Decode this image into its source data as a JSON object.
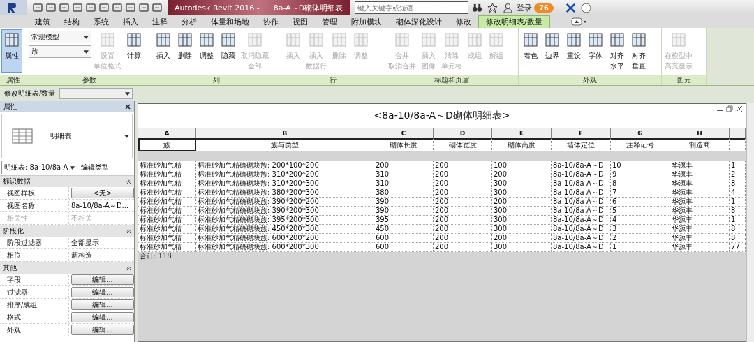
{
  "title_bar": {
    "app_title": "Autodesk Revit 2016 -",
    "doc_title": "8a-A～D砌体明细表",
    "search": {
      "placeholder": "键入关键字或短语"
    },
    "sign_in": "登录",
    "badge": "76"
  },
  "tabs": [
    {
      "label": "建筑",
      "selected": false
    },
    {
      "label": "结构",
      "selected": false
    },
    {
      "label": "系统",
      "selected": false
    },
    {
      "label": "插入",
      "selected": false
    },
    {
      "label": "注释",
      "selected": false
    },
    {
      "label": "分析",
      "selected": false
    },
    {
      "label": "体量和场地",
      "selected": false
    },
    {
      "label": "协作",
      "selected": false
    },
    {
      "label": "视图",
      "selected": false
    },
    {
      "label": "管理",
      "selected": false
    },
    {
      "label": "附加模块",
      "selected": false
    },
    {
      "label": "砌体深化设计",
      "selected": false
    },
    {
      "label": "修改",
      "selected": false
    },
    {
      "label": "修改明细表/数量",
      "selected": true
    }
  ],
  "ribbon": [
    {
      "label": "属性",
      "items": [
        {
          "kind": "large",
          "label": [
            "属性"
          ],
          "disabled": false,
          "active": true
        }
      ]
    },
    {
      "label": "参数",
      "items": [
        {
          "kind": "combos",
          "values": [
            "常规模型",
            "族"
          ]
        },
        {
          "kind": "large",
          "label": [
            "设置",
            "单位格式"
          ],
          "disabled": true,
          "active": false
        },
        {
          "kind": "large",
          "label": [
            "计算"
          ],
          "disabled": false,
          "active": false
        }
      ]
    },
    {
      "label": "列",
      "items": [
        {
          "kind": "large",
          "label": [
            "插入"
          ],
          "disabled": false,
          "active": false
        },
        {
          "kind": "large",
          "label": [
            "删除"
          ],
          "disabled": false,
          "active": false
        },
        {
          "kind": "large",
          "label": [
            "调整"
          ],
          "disabled": false,
          "active": false
        },
        {
          "kind": "large",
          "label": [
            "隐藏"
          ],
          "disabled": false,
          "active": false
        },
        {
          "kind": "large",
          "label": [
            "取消隐藏",
            "全部"
          ],
          "disabled": true,
          "active": false
        }
      ]
    },
    {
      "label": "行",
      "items": [
        {
          "kind": "large",
          "label": [
            "插入"
          ],
          "disabled": true,
          "active": false
        },
        {
          "kind": "large",
          "label": [
            "插入",
            "数据行"
          ],
          "disabled": true,
          "active": false
        },
        {
          "kind": "large",
          "label": [
            "删除"
          ],
          "disabled": true,
          "active": false
        },
        {
          "kind": "large",
          "label": [
            "调整"
          ],
          "disabled": true,
          "active": false
        }
      ]
    },
    {
      "label": "标题和页眉",
      "items": [
        {
          "kind": "large",
          "label": [
            "合并",
            "取消合并"
          ],
          "disabled": true,
          "active": false
        },
        {
          "kind": "large",
          "label": [
            "插入",
            "图像"
          ],
          "disabled": true,
          "active": false
        },
        {
          "kind": "large",
          "label": [
            "清除",
            "单元格"
          ],
          "disabled": true,
          "active": false
        },
        {
          "kind": "large",
          "label": [
            "成组"
          ],
          "disabled": true,
          "active": false
        },
        {
          "kind": "large",
          "label": [
            "解组"
          ],
          "disabled": true,
          "active": false
        }
      ]
    },
    {
      "label": "外观",
      "items": [
        {
          "kind": "large",
          "label": [
            "着色"
          ],
          "disabled": false,
          "active": false
        },
        {
          "kind": "large",
          "label": [
            "边界"
          ],
          "disabled": false,
          "active": false
        },
        {
          "kind": "large",
          "label": [
            "重设"
          ],
          "disabled": false,
          "active": false
        },
        {
          "kind": "large",
          "label": [
            "字体"
          ],
          "disabled": false,
          "active": false
        },
        {
          "kind": "large",
          "label": [
            "对齐",
            "水平"
          ],
          "disabled": false,
          "active": false
        },
        {
          "kind": "large",
          "label": [
            "对齐",
            "垂直"
          ],
          "disabled": false,
          "active": false
        }
      ]
    },
    {
      "label": "图元",
      "items": [
        {
          "kind": "large",
          "label": [
            "在模型中",
            "高亮显示"
          ],
          "disabled": true,
          "active": false
        }
      ]
    }
  ],
  "options_bar": {
    "label": "修改明细表/数量"
  },
  "properties": {
    "title": "属性",
    "type_name": "明细表",
    "instance": "明细表: 8a-10/8a-A",
    "edit_type": "编辑类型",
    "groups": [
      {
        "name": "标识数据",
        "rows": [
          {
            "kind": "button",
            "label": "视图样板",
            "value": "<无>",
            "disabled": false
          },
          {
            "kind": "text",
            "label": "视图名称",
            "value": "8a-10/8a-A～D...",
            "disabled": false
          },
          {
            "kind": "text",
            "label": "相关性",
            "value": "不相关",
            "disabled": true
          }
        ]
      },
      {
        "name": "阶段化",
        "rows": [
          {
            "kind": "text",
            "label": "阶段过滤器",
            "value": "全部显示",
            "disabled": false
          },
          {
            "kind": "text",
            "label": "相位",
            "value": "新构造",
            "disabled": false
          }
        ]
      },
      {
        "name": "其他",
        "rows": [
          {
            "kind": "button",
            "label": "字段",
            "value": "编辑...",
            "disabled": false
          },
          {
            "kind": "button",
            "label": "过滤器",
            "value": "编辑...",
            "disabled": false
          },
          {
            "kind": "button",
            "label": "排序/成组",
            "value": "编辑...",
            "disabled": false
          },
          {
            "kind": "button",
            "label": "格式",
            "value": "编辑...",
            "disabled": false
          },
          {
            "kind": "button",
            "label": "外观",
            "value": "编辑...",
            "disabled": false
          }
        ]
      }
    ]
  },
  "schedule": {
    "title": "<8a-10/8a-A～D砌体明细表>",
    "columns": [
      {
        "letter": "A",
        "name": "族"
      },
      {
        "letter": "B",
        "name": "族与类型"
      },
      {
        "letter": "C",
        "name": "砌体长度"
      },
      {
        "letter": "D",
        "name": "砌体宽度"
      },
      {
        "letter": "E",
        "name": "砌体高度"
      },
      {
        "letter": "F",
        "name": "墙体定位"
      },
      {
        "letter": "G",
        "name": "注释记号"
      },
      {
        "letter": "H",
        "name": "制造商"
      }
    ],
    "rows": [
      [
        "标准砂加气精",
        "标准砂加气精确砌块族: 200*100*200",
        "200",
        "200",
        "100",
        "8a-10/8a-A～D",
        "10",
        "华源丰",
        "1"
      ],
      [
        "标准砂加气精",
        "标准砂加气精确砌块族: 310*200*200",
        "310",
        "200",
        "200",
        "8a-10/8a-A～D",
        "9",
        "华源丰",
        "2"
      ],
      [
        "标准砂加气精",
        "标准砂加气精确砌块族: 310*200*300",
        "310",
        "200",
        "300",
        "8a-10/8a-A～D",
        "8",
        "华源丰",
        "8"
      ],
      [
        "标准砂加气精",
        "标准砂加气精确砌块族: 380*200*300",
        "380",
        "200",
        "300",
        "8a-10/8a-A～D",
        "7",
        "华源丰",
        "4"
      ],
      [
        "标准砂加气精",
        "标准砂加气精确砌块族: 390*200*200",
        "390",
        "200",
        "200",
        "8a-10/8a-A～D",
        "6",
        "华源丰",
        "1"
      ],
      [
        "标准砂加气精",
        "标准砂加气精确砌块族: 390*200*300",
        "390",
        "200",
        "300",
        "8a-10/8a-A～D",
        "5",
        "华源丰",
        "8"
      ],
      [
        "标准砂加气精",
        "标准砂加气精确砌块族: 395*200*300",
        "395",
        "200",
        "300",
        "8a-10/8a-A～D",
        "4",
        "华源丰",
        "1"
      ],
      [
        "标准砂加气精",
        "标准砂加气精确砌块族: 450*200*300",
        "450",
        "200",
        "300",
        "8a-10/8a-A～D",
        "3",
        "华源丰",
        "8"
      ],
      [
        "标准砂加气精",
        "标准砂加气精确砌块族: 600*200*200",
        "600",
        "200",
        "200",
        "8a-10/8a-A～D",
        "2",
        "华源丰",
        "8"
      ],
      [
        "标准砂加气精",
        "标准砂加气精确砌块族: 600*200*300",
        "600",
        "200",
        "300",
        "8a-10/8a-A～D",
        "1",
        "华源丰",
        "77"
      ]
    ],
    "total": "合计: 118"
  }
}
